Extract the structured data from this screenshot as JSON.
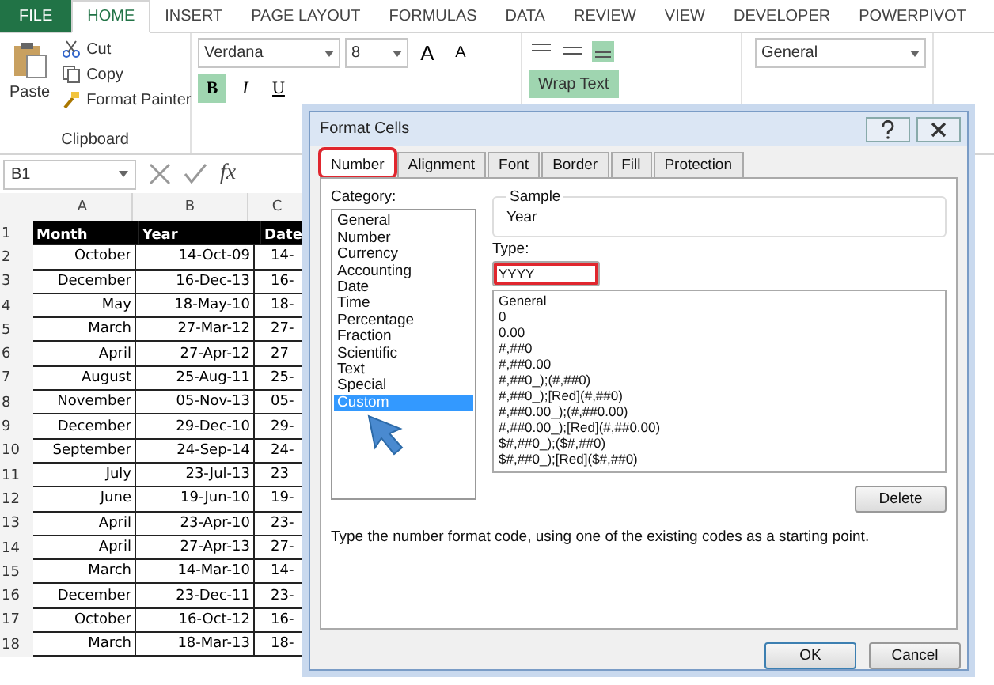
{
  "ribbon": {
    "tabs": [
      {
        "label": "FILE",
        "kind": "file",
        "selected": false
      },
      {
        "label": "HOME",
        "kind": "tab",
        "selected": true
      },
      {
        "label": "INSERT",
        "kind": "tab",
        "selected": false
      },
      {
        "label": "PAGE LAYOUT",
        "kind": "tab",
        "selected": false
      },
      {
        "label": "FORMULAS",
        "kind": "tab",
        "selected": false
      },
      {
        "label": "DATA",
        "kind": "tab",
        "selected": false
      },
      {
        "label": "REVIEW",
        "kind": "tab",
        "selected": false
      },
      {
        "label": "VIEW",
        "kind": "tab",
        "selected": false
      },
      {
        "label": "DEVELOPER",
        "kind": "tab",
        "selected": false
      },
      {
        "label": "POWERPIVOT",
        "kind": "tab",
        "selected": false
      }
    ],
    "clipboard": {
      "paste": "Paste",
      "cut": "Cut",
      "copy": "Copy",
      "format_painter": "Format Painter",
      "label": "Clipboard"
    },
    "font": {
      "name": "Verdana",
      "size": "8",
      "grow": "A",
      "shrink": "A",
      "bold_label": "B",
      "italic_label": "I",
      "underline_label": "U",
      "bold": true
    },
    "wrap_text": {
      "label": "Wrap Text",
      "on": true
    },
    "number_format": "General"
  },
  "formula_bar": {
    "name_box": "B1",
    "fx": "fx"
  },
  "sheet": {
    "columns": [
      "A",
      "B",
      "C"
    ],
    "rows": [
      {
        "num": "1",
        "header": true,
        "cells": [
          "Month",
          "Year",
          "Date"
        ]
      },
      {
        "num": "2",
        "header": false,
        "cells": [
          "October",
          "14-Oct-09",
          "14-"
        ]
      },
      {
        "num": "3",
        "header": false,
        "cells": [
          "December",
          "16-Dec-13",
          "16-"
        ]
      },
      {
        "num": "4",
        "header": false,
        "cells": [
          "May",
          "18-May-10",
          "18-"
        ]
      },
      {
        "num": "5",
        "header": false,
        "cells": [
          "March",
          "27-Mar-12",
          "27-"
        ]
      },
      {
        "num": "6",
        "header": false,
        "cells": [
          "April",
          "27-Apr-12",
          "27"
        ]
      },
      {
        "num": "7",
        "header": false,
        "cells": [
          "August",
          "25-Aug-11",
          "25-"
        ]
      },
      {
        "num": "8",
        "header": false,
        "cells": [
          "November",
          "05-Nov-13",
          "05-"
        ]
      },
      {
        "num": "9",
        "header": false,
        "cells": [
          "December",
          "29-Dec-10",
          "29-"
        ]
      },
      {
        "num": "10",
        "header": false,
        "cells": [
          "September",
          "24-Sep-14",
          "24-"
        ]
      },
      {
        "num": "11",
        "header": false,
        "cells": [
          "July",
          "23-Jul-13",
          "23"
        ]
      },
      {
        "num": "12",
        "header": false,
        "cells": [
          "June",
          "19-Jun-10",
          "19-"
        ]
      },
      {
        "num": "13",
        "header": false,
        "cells": [
          "April",
          "23-Apr-10",
          "23-"
        ]
      },
      {
        "num": "14",
        "header": false,
        "cells": [
          "April",
          "27-Apr-13",
          "27-"
        ]
      },
      {
        "num": "15",
        "header": false,
        "cells": [
          "March",
          "14-Mar-10",
          "14-"
        ]
      },
      {
        "num": "16",
        "header": false,
        "cells": [
          "December",
          "23-Dec-11",
          "23-"
        ]
      },
      {
        "num": "17",
        "header": false,
        "cells": [
          "October",
          "16-Oct-12",
          "16-"
        ]
      },
      {
        "num": "18",
        "header": false,
        "cells": [
          "March",
          "18-Mar-13",
          "18-"
        ]
      }
    ]
  },
  "dialog": {
    "title": "Format Cells",
    "tabs": [
      {
        "label": "Number",
        "selected": true,
        "highlighted": true
      },
      {
        "label": "Alignment",
        "selected": false,
        "highlighted": false
      },
      {
        "label": "Font",
        "selected": false,
        "highlighted": false
      },
      {
        "label": "Border",
        "selected": false,
        "highlighted": false
      },
      {
        "label": "Fill",
        "selected": false,
        "highlighted": false
      },
      {
        "label": "Protection",
        "selected": false,
        "highlighted": false
      }
    ],
    "category_label": "Category:",
    "categories": [
      {
        "label": "General",
        "selected": false
      },
      {
        "label": "Number",
        "selected": false
      },
      {
        "label": "Currency",
        "selected": false
      },
      {
        "label": "Accounting",
        "selected": false
      },
      {
        "label": "Date",
        "selected": false
      },
      {
        "label": "Time",
        "selected": false
      },
      {
        "label": "Percentage",
        "selected": false
      },
      {
        "label": "Fraction",
        "selected": false
      },
      {
        "label": "Scientific",
        "selected": false
      },
      {
        "label": "Text",
        "selected": false
      },
      {
        "label": "Special",
        "selected": false
      },
      {
        "label": "Custom",
        "selected": true
      }
    ],
    "sample_label": "Sample",
    "sample_value": "Year",
    "type_label": "Type:",
    "type_value": "YYYY",
    "type_highlighted": true,
    "formats": [
      "General",
      "0",
      "0.00",
      "#,##0",
      "#,##0.00",
      "#,##0_);(#,##0)",
      "#,##0_);[Red](#,##0)",
      "#,##0.00_);(#,##0.00)",
      "#,##0.00_);[Red](#,##0.00)",
      "$#,##0_);($#,##0)",
      "$#,##0_);[Red]($#,##0)"
    ],
    "delete": "Delete",
    "description": "Type the number format code, using one of the existing codes as a starting point.",
    "ok": "OK",
    "cancel": "Cancel"
  }
}
